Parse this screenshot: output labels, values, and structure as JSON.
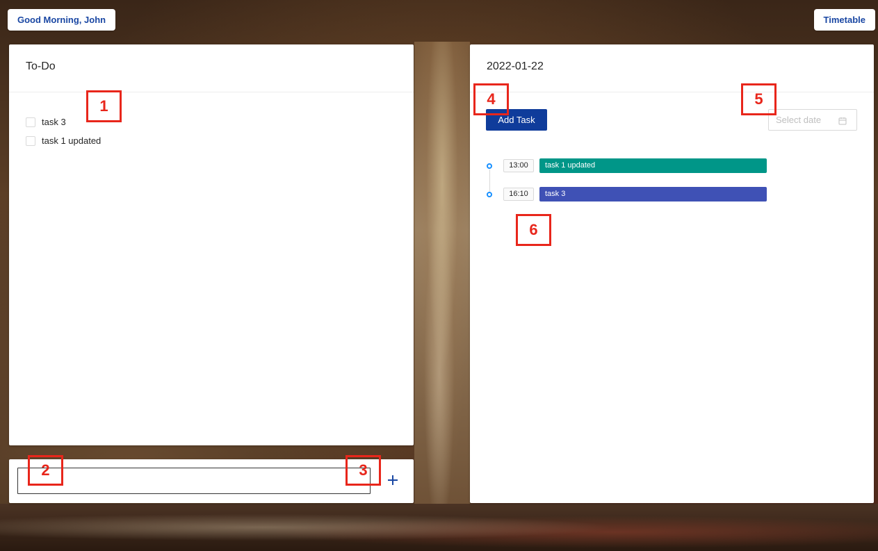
{
  "header": {
    "greeting": "Good Morning, John",
    "timetable_label": "Timetable"
  },
  "todo": {
    "title": "To-Do",
    "items": [
      {
        "label": "task 3",
        "checked": false
      },
      {
        "label": "task 1 updated",
        "checked": false
      }
    ],
    "new_task_value": "",
    "add_icon": "plus-icon"
  },
  "timetable": {
    "date": "2022-01-22",
    "add_task_label": "Add Task",
    "date_picker_placeholder": "Select date",
    "date_picker_icon": "calendar-icon",
    "entries": [
      {
        "time": "13:00",
        "label": "task 1 updated",
        "color": "#009688"
      },
      {
        "time": "16:10",
        "label": "task 3",
        "color": "#3f51b5"
      }
    ]
  },
  "markers": [
    "1",
    "2",
    "3",
    "4",
    "5",
    "6"
  ],
  "colors": {
    "accent": "#1a47a3",
    "primary_button": "#0f3c9b",
    "timeline_dot": "#1890ff",
    "marker": "#e8261b"
  }
}
